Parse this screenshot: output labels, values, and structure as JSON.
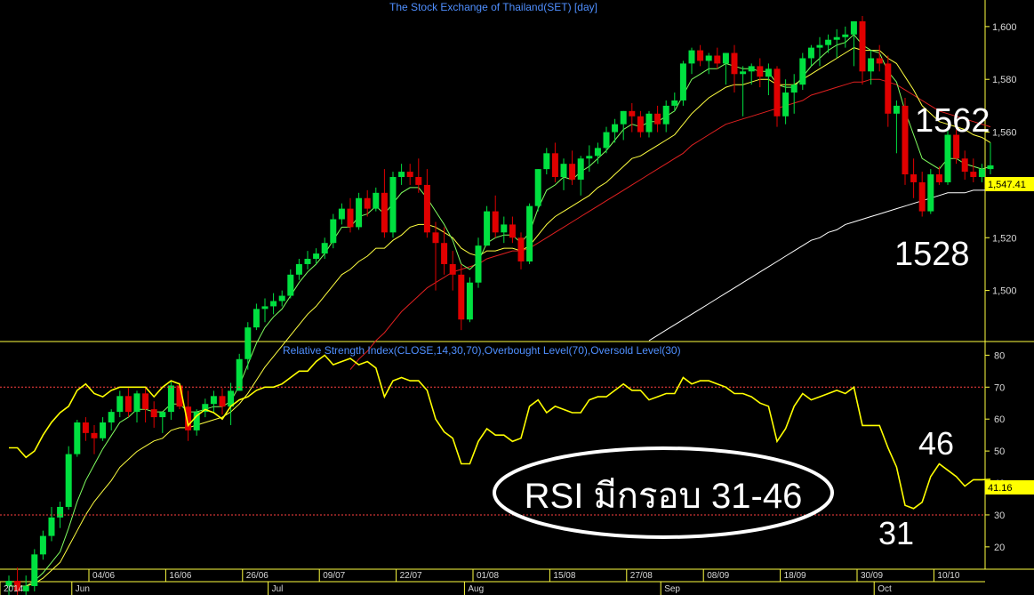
{
  "chart_data": [
    {
      "type": "candlestick",
      "title": "The Stock Exchange of Thailand(SET) [day]",
      "y_ticks": [
        "1,500",
        "1,520",
        "1,540",
        "1,560",
        "1,580",
        "1,600"
      ],
      "ylim": [
        1481,
        1604
      ],
      "last_price_label": "1,547.41",
      "annotations": {
        "high": "1562",
        "low": "1528"
      },
      "colors": {
        "up": "#00e040",
        "down": "#e00000",
        "ema_fast": "#80ff60",
        "ema_slow": "#ffff40",
        "ma_mid": "#e02020",
        "ma_long": "#ffffff"
      },
      "candles": [
        [
          1388,
          1392,
          1375,
          1390
        ],
        [
          1390,
          1395,
          1378,
          1386
        ],
        [
          1386,
          1392,
          1381,
          1388
        ],
        [
          1388,
          1402,
          1386,
          1400
        ],
        [
          1400,
          1409,
          1398,
          1407
        ],
        [
          1407,
          1418,
          1405,
          1414
        ],
        [
          1414,
          1420,
          1410,
          1418
        ],
        [
          1418,
          1441,
          1417,
          1438
        ],
        [
          1438,
          1451,
          1437,
          1450
        ],
        [
          1450,
          1452,
          1443,
          1446
        ],
        [
          1446,
          1449,
          1438,
          1444
        ],
        [
          1444,
          1452,
          1443,
          1450
        ],
        [
          1450,
          1455,
          1447,
          1454
        ],
        [
          1454,
          1462,
          1452,
          1460
        ],
        [
          1460,
          1463,
          1452,
          1454
        ],
        [
          1454,
          1462,
          1450,
          1461
        ],
        [
          1461,
          1463,
          1450,
          1455
        ],
        [
          1455,
          1458,
          1448,
          1452
        ],
        [
          1452,
          1454,
          1446,
          1454
        ],
        [
          1454,
          1466,
          1451,
          1464
        ],
        [
          1464,
          1465,
          1455,
          1456
        ],
        [
          1456,
          1462,
          1443,
          1447
        ],
        [
          1447,
          1455,
          1445,
          1454
        ],
        [
          1454,
          1459,
          1452,
          1457
        ],
        [
          1457,
          1462,
          1454,
          1460
        ],
        [
          1460,
          1463,
          1453,
          1456
        ],
        [
          1456,
          1465,
          1449,
          1462
        ],
        [
          1462,
          1476,
          1462,
          1474
        ],
        [
          1474,
          1488,
          1470,
          1486
        ],
        [
          1486,
          1495,
          1485,
          1493
        ],
        [
          1493,
          1497,
          1488,
          1494
        ],
        [
          1494,
          1499,
          1491,
          1496
        ],
        [
          1496,
          1500,
          1494,
          1498
        ],
        [
          1498,
          1508,
          1497,
          1506
        ],
        [
          1506,
          1512,
          1504,
          1510
        ],
        [
          1510,
          1515,
          1508,
          1512
        ],
        [
          1512,
          1516,
          1510,
          1514
        ],
        [
          1514,
          1520,
          1512,
          1518
        ],
        [
          1518,
          1529,
          1516,
          1527
        ],
        [
          1527,
          1533,
          1525,
          1531
        ],
        [
          1531,
          1535,
          1522,
          1524
        ],
        [
          1524,
          1537,
          1523,
          1535
        ],
        [
          1535,
          1538,
          1528,
          1531
        ],
        [
          1531,
          1539,
          1530,
          1537
        ],
        [
          1537,
          1546,
          1520,
          1522
        ],
        [
          1522,
          1545,
          1520,
          1543
        ],
        [
          1543,
          1548,
          1540,
          1545
        ],
        [
          1545,
          1548,
          1540,
          1543
        ],
        [
          1543,
          1550,
          1537,
          1540
        ],
        [
          1540,
          1546,
          1520,
          1522
        ],
        [
          1522,
          1526,
          1500,
          1518
        ],
        [
          1518,
          1524,
          1506,
          1510
        ],
        [
          1510,
          1515,
          1500,
          1506
        ],
        [
          1506,
          1510,
          1485,
          1489
        ],
        [
          1489,
          1505,
          1488,
          1503
        ],
        [
          1503,
          1520,
          1501,
          1517
        ],
        [
          1517,
          1532,
          1517,
          1530
        ],
        [
          1530,
          1536,
          1520,
          1522
        ],
        [
          1522,
          1528,
          1518,
          1525
        ],
        [
          1525,
          1528,
          1518,
          1520
        ],
        [
          1520,
          1522,
          1508,
          1511
        ],
        [
          1511,
          1533,
          1510,
          1532
        ],
        [
          1532,
          1546,
          1530,
          1546
        ],
        [
          1546,
          1554,
          1544,
          1552
        ],
        [
          1552,
          1556,
          1541,
          1543
        ],
        [
          1543,
          1550,
          1538,
          1548
        ],
        [
          1548,
          1553,
          1540,
          1542
        ],
        [
          1542,
          1551,
          1536,
          1550
        ],
        [
          1550,
          1555,
          1545,
          1551
        ],
        [
          1551,
          1556,
          1548,
          1554
        ],
        [
          1554,
          1562,
          1552,
          1560
        ],
        [
          1560,
          1565,
          1556,
          1563
        ],
        [
          1563,
          1568,
          1557,
          1568
        ],
        [
          1568,
          1571,
          1560,
          1566
        ],
        [
          1566,
          1568,
          1558,
          1560
        ],
        [
          1560,
          1568,
          1558,
          1567
        ],
        [
          1567,
          1570,
          1560,
          1563
        ],
        [
          1563,
          1572,
          1560,
          1570
        ],
        [
          1570,
          1575,
          1568,
          1572
        ],
        [
          1572,
          1587,
          1570,
          1586
        ],
        [
          1586,
          1592,
          1582,
          1591
        ],
        [
          1591,
          1593,
          1585,
          1587
        ],
        [
          1587,
          1590,
          1582,
          1589
        ],
        [
          1589,
          1592,
          1584,
          1586
        ],
        [
          1586,
          1590,
          1578,
          1590
        ],
        [
          1590,
          1593,
          1575,
          1582
        ],
        [
          1582,
          1585,
          1566,
          1583
        ],
        [
          1583,
          1586,
          1578,
          1585
        ],
        [
          1585,
          1588,
          1577,
          1581
        ],
        [
          1581,
          1586,
          1574,
          1584
        ],
        [
          1584,
          1585,
          1562,
          1566
        ],
        [
          1566,
          1580,
          1563,
          1575
        ],
        [
          1575,
          1582,
          1567,
          1578
        ],
        [
          1578,
          1590,
          1576,
          1588
        ],
        [
          1588,
          1593,
          1585,
          1592
        ],
        [
          1592,
          1596,
          1585,
          1593
        ],
        [
          1593,
          1597,
          1590,
          1595
        ],
        [
          1595,
          1599,
          1588,
          1596
        ],
        [
          1596,
          1600,
          1592,
          1597
        ],
        [
          1597,
          1602,
          1585,
          1602
        ],
        [
          1602,
          1604,
          1578,
          1583
        ],
        [
          1583,
          1591,
          1578,
          1588
        ],
        [
          1588,
          1593,
          1583,
          1586
        ],
        [
          1586,
          1589,
          1562,
          1567
        ],
        [
          1567,
          1572,
          1552,
          1570
        ],
        [
          1570,
          1573,
          1540,
          1544
        ],
        [
          1544,
          1550,
          1535,
          1541
        ],
        [
          1541,
          1545,
          1528,
          1530
        ],
        [
          1530,
          1546,
          1529,
          1544
        ],
        [
          1544,
          1547,
          1540,
          1541
        ],
        [
          1541,
          1561,
          1540,
          1559
        ],
        [
          1559,
          1561,
          1548,
          1550
        ],
        [
          1550,
          1553,
          1542,
          1545
        ],
        [
          1545,
          1550,
          1541,
          1543
        ],
        [
          1543,
          1548,
          1541,
          1546
        ],
        [
          1546,
          1556,
          1544,
          1547.41
        ]
      ],
      "ema_fast": [
        1388,
        1388,
        1388,
        1390,
        1393,
        1397,
        1401,
        1410,
        1420,
        1428,
        1434,
        1440,
        1445,
        1450,
        1452,
        1455,
        1455,
        1454,
        1454,
        1457,
        1457,
        1454,
        1454,
        1455,
        1456,
        1456,
        1458,
        1464,
        1472,
        1480,
        1486,
        1490,
        1493,
        1498,
        1503,
        1507,
        1510,
        1514,
        1519,
        1524,
        1524,
        1528,
        1529,
        1532,
        1529,
        1533,
        1537,
        1539,
        1539,
        1535,
        1530,
        1525,
        1519,
        1510,
        1508,
        1511,
        1518,
        1520,
        1521,
        1521,
        1518,
        1522,
        1531,
        1538,
        1540,
        1543,
        1542,
        1545,
        1547,
        1550,
        1553,
        1557,
        1561,
        1563,
        1562,
        1564,
        1564,
        1566,
        1568,
        1574,
        1580,
        1582,
        1584,
        1584,
        1586,
        1585,
        1584,
        1584,
        1583,
        1583,
        1578,
        1577,
        1577,
        1581,
        1585,
        1588,
        1591,
        1593,
        1594,
        1597,
        1593,
        1591,
        1590,
        1583,
        1579,
        1568,
        1559,
        1550,
        1548,
        1546,
        1550,
        1550,
        1548,
        1547,
        1546,
        1547
      ],
      "ema_slow": [
        1388,
        1388,
        1388,
        1389,
        1391,
        1394,
        1397,
        1403,
        1409,
        1415,
        1420,
        1424,
        1428,
        1433,
        1436,
        1439,
        1441,
        1443,
        1444,
        1447,
        1448,
        1448,
        1449,
        1450,
        1451,
        1452,
        1454,
        1457,
        1461,
        1466,
        1471,
        1475,
        1479,
        1483,
        1487,
        1491,
        1494,
        1498,
        1502,
        1506,
        1508,
        1511,
        1513,
        1516,
        1516,
        1519,
        1521,
        1524,
        1525,
        1525,
        1524,
        1522,
        1520,
        1516,
        1514,
        1513,
        1515,
        1515,
        1516,
        1516,
        1515,
        1517,
        1521,
        1525,
        1528,
        1530,
        1532,
        1534,
        1536,
        1539,
        1541,
        1544,
        1547,
        1550,
        1551,
        1553,
        1555,
        1557,
        1559,
        1563,
        1567,
        1570,
        1573,
        1575,
        1577,
        1578,
        1578,
        1579,
        1580,
        1580,
        1578,
        1578,
        1578,
        1580,
        1582,
        1584,
        1586,
        1588,
        1590,
        1592,
        1591,
        1591,
        1591,
        1588,
        1586,
        1581,
        1576,
        1570,
        1567,
        1564,
        1563,
        1562,
        1561,
        1559,
        1558,
        1556
      ],
      "ma_mid": [
        null,
        null,
        null,
        null,
        null,
        null,
        null,
        null,
        null,
        null,
        null,
        null,
        null,
        null,
        null,
        null,
        null,
        null,
        null,
        null,
        null,
        null,
        null,
        null,
        null,
        null,
        null,
        null,
        null,
        null,
        null,
        null,
        null,
        null,
        null,
        null,
        null,
        null,
        null,
        null,
        1470,
        1474,
        1477,
        1481,
        1484,
        1488,
        1492,
        1495,
        1498,
        1501,
        1503,
        1505,
        1507,
        1508,
        1509,
        1510,
        1512,
        1513,
        1514,
        1515,
        1515,
        1516,
        1518,
        1520,
        1522,
        1524,
        1526,
        1528,
        1530,
        1532,
        1534,
        1536,
        1538,
        1540,
        1542,
        1544,
        1546,
        1548,
        1550,
        1552,
        1555,
        1557,
        1559,
        1561,
        1563,
        1564,
        1565,
        1566,
        1567,
        1568,
        1569,
        1570,
        1571,
        1572,
        1574,
        1575,
        1576,
        1577,
        1578,
        1579,
        1579,
        1580,
        1580,
        1579,
        1578,
        1576,
        1574,
        1572,
        1570,
        1568,
        1567,
        1566,
        1565,
        1564,
        1563,
        1562
      ],
      "ma_long": [
        null,
        null,
        null,
        null,
        null,
        null,
        null,
        null,
        null,
        null,
        null,
        null,
        null,
        null,
        null,
        null,
        null,
        null,
        null,
        null,
        null,
        null,
        null,
        null,
        null,
        null,
        null,
        null,
        null,
        null,
        null,
        null,
        null,
        null,
        null,
        null,
        null,
        null,
        null,
        null,
        null,
        null,
        null,
        null,
        null,
        null,
        null,
        null,
        null,
        null,
        null,
        null,
        null,
        null,
        null,
        null,
        null,
        null,
        null,
        null,
        null,
        null,
        null,
        null,
        null,
        null,
        null,
        null,
        null,
        null,
        null,
        null,
        null,
        null,
        null,
        1481,
        1483,
        1485,
        1487,
        1489,
        1491,
        1493,
        1495,
        1497,
        1499,
        1501,
        1503,
        1505,
        1507,
        1509,
        1511,
        1513,
        1515,
        1517,
        1519,
        1520,
        1522,
        1523,
        1525,
        1526,
        1527,
        1528,
        1529,
        1530,
        1531,
        1532,
        1533,
        1534,
        1535,
        1536,
        1537,
        1537,
        1537,
        1538,
        1538,
        1538
      ]
    },
    {
      "type": "line",
      "title": "Relative Strength Index(CLOSE,14,30,70),Overbought Level(70),Oversold Level(30)",
      "y_ticks": [
        "20",
        "30",
        "40",
        "50",
        "60",
        "70",
        "80"
      ],
      "ylim": [
        13,
        84
      ],
      "reference_lines": [
        70,
        30
      ],
      "last_value_label": "41.16",
      "annotations": {
        "high": "46",
        "low": "31"
      },
      "overlay_label": "RSI มีกรอบ 31-46",
      "values": [
        51,
        51,
        48,
        50,
        55,
        59,
        62,
        64,
        69,
        71,
        68,
        67,
        69,
        70,
        70,
        70,
        70,
        67,
        70,
        72,
        71,
        58,
        61,
        63,
        62,
        60,
        64,
        66,
        67,
        69,
        70,
        70,
        71,
        73,
        75,
        75,
        78,
        80,
        77,
        78,
        79,
        77,
        78,
        76,
        67,
        72,
        73,
        72,
        72,
        69,
        60,
        56,
        54,
        46,
        46,
        53,
        57,
        55,
        55,
        53,
        54,
        64,
        66,
        62,
        64,
        63,
        62,
        62,
        66,
        67,
        67,
        69,
        71,
        69,
        69,
        66,
        67,
        68,
        68,
        73,
        71,
        72,
        72,
        71,
        70,
        68,
        68,
        67,
        65,
        64,
        53,
        57,
        64,
        68,
        66,
        67,
        68,
        69,
        68,
        70,
        58,
        58,
        58,
        51,
        45,
        33,
        32,
        34,
        42,
        46,
        44,
        42,
        39,
        41,
        41,
        41.16
      ]
    }
  ],
  "x_axis": {
    "day_labels": [
      "04/06",
      "16/06",
      "26/06",
      "09/07",
      "22/07",
      "01/08",
      "15/08",
      "27/08",
      "08/09",
      "18/09",
      "30/09",
      "10/10"
    ],
    "month_labels": [
      "2014",
      "Jun",
      "Jul",
      "Aug",
      "Sep",
      "Oct"
    ]
  }
}
